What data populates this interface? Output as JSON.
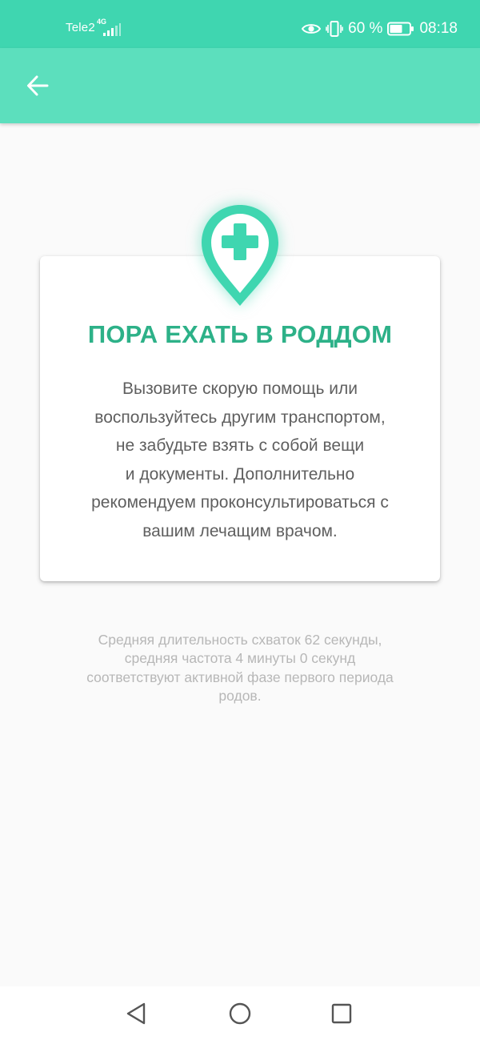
{
  "status_bar": {
    "carrier": "Tele2",
    "network": "4G",
    "battery": "60 %",
    "time": "08:18"
  },
  "app_bar": {
    "back_icon": "arrow-left-icon"
  },
  "card": {
    "icon": "medical-location-pin-icon",
    "title": "ПОРА ЕХАТЬ В РОДДОМ",
    "message_lines": [
      "Вызовите скорую помощь или",
      "воспользуйтесь другим транспортом,",
      "не забудьте взять с собой вещи",
      "и документы. Дополнительно",
      "рекомендуем проконсультироваться с",
      "вашим лечащим врачом."
    ]
  },
  "summary_lines": [
    "Средняя длительность схваток 62 секунды,",
    "средняя частота 4 минуты 0 секунд",
    "соответствуют активной фазе первого периода",
    "родов."
  ],
  "nav_bar": {
    "back": "triangle-back-icon",
    "home": "circle-home-icon",
    "recents": "square-recents-icon"
  },
  "colors": {
    "status_bar": "#3fd6b0",
    "app_bar": "#5cdfbd",
    "accent": "#3fd6b0",
    "title": "#2db188",
    "body_text": "#5f5f5f",
    "note_text": "#b7b7b7"
  }
}
